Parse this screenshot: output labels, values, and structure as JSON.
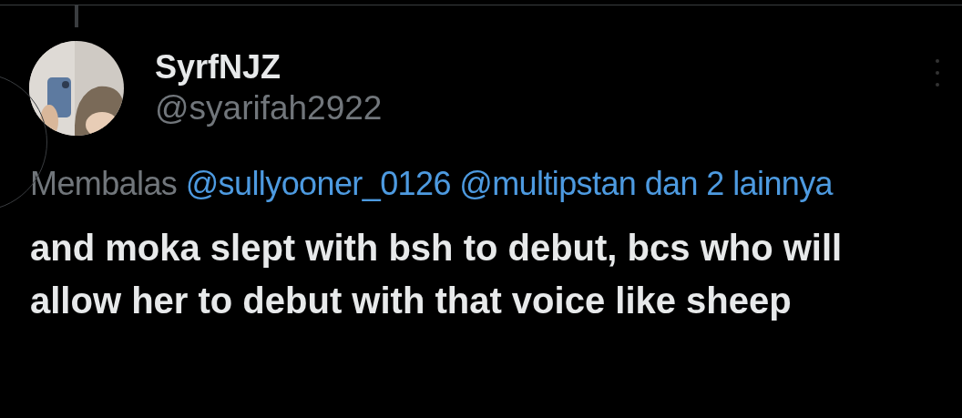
{
  "author": {
    "name": "SyrfNJZ",
    "handle": "@syarifah2922"
  },
  "reply_to": {
    "prefix": "Membalas",
    "mentions": [
      "@sullyooner_0126",
      "@multipstan"
    ],
    "others": "dan 2 lainnya"
  },
  "text": "and moka slept with bsh to debut, bcs who will allow her to debut with that voice like sheep"
}
